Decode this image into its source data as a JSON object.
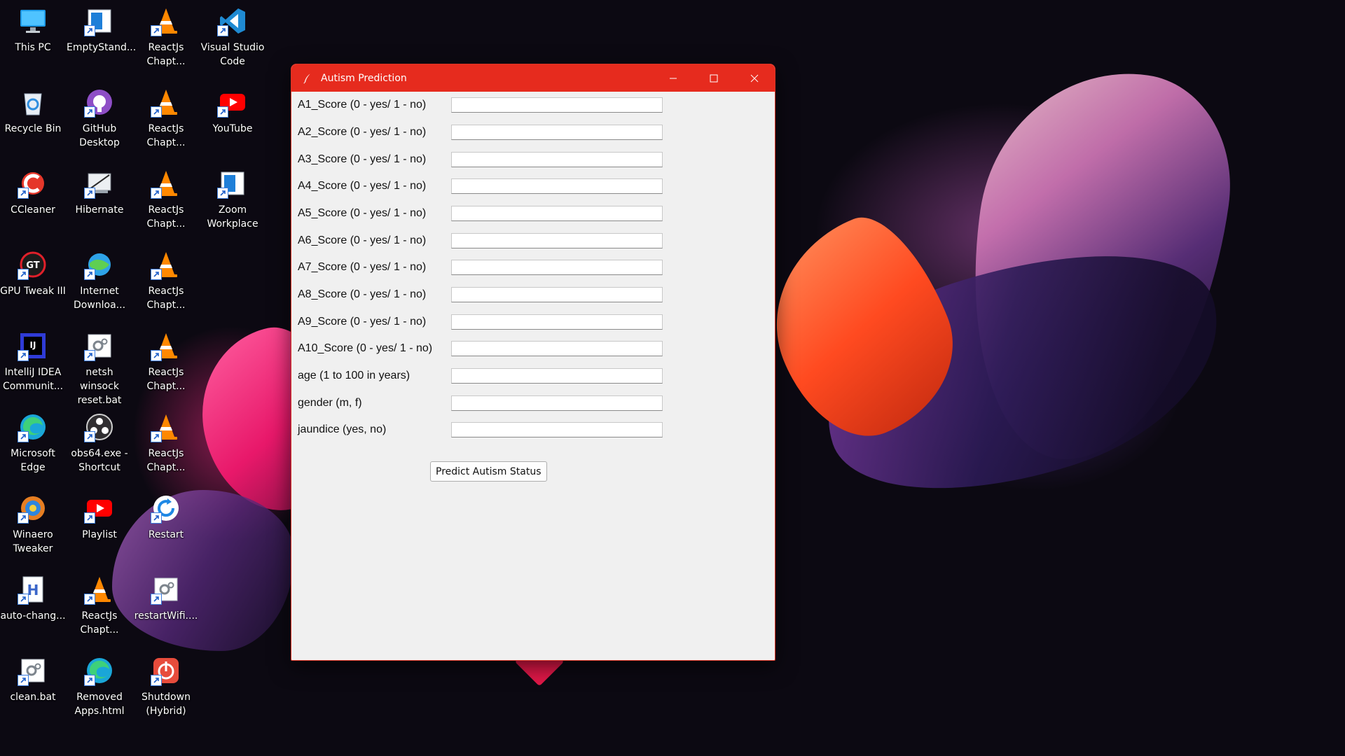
{
  "window": {
    "title": "Autism Prediction",
    "minimize_label": "Minimize",
    "maximize_label": "Maximize",
    "close_label": "Close"
  },
  "form": {
    "fields": [
      {
        "label": "A1_Score (0 - yes/ 1 - no)",
        "value": ""
      },
      {
        "label": "A2_Score (0 - yes/ 1 - no)",
        "value": ""
      },
      {
        "label": "A3_Score (0 - yes/ 1 - no)",
        "value": ""
      },
      {
        "label": "A4_Score (0 - yes/ 1 - no)",
        "value": ""
      },
      {
        "label": "A5_Score (0 - yes/ 1 - no)",
        "value": ""
      },
      {
        "label": "A6_Score (0 - yes/ 1 - no)",
        "value": ""
      },
      {
        "label": "A7_Score (0 - yes/ 1 - no)",
        "value": ""
      },
      {
        "label": "A8_Score (0 - yes/ 1 - no)",
        "value": ""
      },
      {
        "label": "A9_Score (0 - yes/ 1 - no)",
        "value": ""
      },
      {
        "label": "A10_Score (0 - yes/ 1 - no)",
        "value": ""
      },
      {
        "label": "age (1 to 100 in years)",
        "value": ""
      },
      {
        "label": "gender (m, f)",
        "value": ""
      },
      {
        "label": "jaundice (yes, no)",
        "value": ""
      }
    ],
    "submit_label": "Predict Autism Status"
  },
  "desktop": {
    "icons": [
      {
        "label": "This PC",
        "icon": "monitor-icon"
      },
      {
        "label": "Recycle Bin",
        "icon": "recycle-bin-icon"
      },
      {
        "label": "CCleaner",
        "icon": "ccleaner-icon"
      },
      {
        "label": "GPU Tweak III",
        "icon": "gpu-tweak-icon"
      },
      {
        "label": "IntelliJ IDEA\nCommunit...",
        "icon": "intellij-icon"
      },
      {
        "label": "Microsoft\nEdge",
        "icon": "edge-icon"
      },
      {
        "label": "Winaero\nTweaker",
        "icon": "winaero-icon"
      },
      {
        "label": "auto-chang...",
        "icon": "script-icon"
      },
      {
        "label": "clean.bat",
        "icon": "batch-gear-icon"
      },
      {
        "label": "EmptyStand...",
        "icon": "app-window-icon"
      },
      {
        "label": "GitHub\nDesktop",
        "icon": "github-icon"
      },
      {
        "label": "Hibernate",
        "icon": "hibernate-icon"
      },
      {
        "label": "Internet\nDownloa...",
        "icon": "idm-globe-icon"
      },
      {
        "label": "netsh winsock\nreset.bat",
        "icon": "batch-gear-icon"
      },
      {
        "label": "obs64.exe -\nShortcut",
        "icon": "obs-icon"
      },
      {
        "label": "Playlist",
        "icon": "youtube-icon"
      },
      {
        "label": "ReactJs\nChapt...",
        "icon": "vlc-cone-icon"
      },
      {
        "label": "ReactJs\nChapt...",
        "icon": "vlc-cone-icon"
      },
      {
        "label": "ReactJs\nChapt...",
        "icon": "vlc-cone-icon"
      },
      {
        "label": "ReactJs\nChapt...",
        "icon": "vlc-cone-icon"
      },
      {
        "label": "ReactJs\nChapt...",
        "icon": "vlc-cone-icon"
      },
      {
        "label": "ReactJs\nChapt...",
        "icon": "vlc-cone-icon"
      },
      {
        "label": "ReactJs\nChapt...",
        "icon": "vlc-cone-icon"
      },
      {
        "label": "Removed\nApps.html",
        "icon": "edge-icon"
      },
      {
        "label": "Restart",
        "icon": "restart-icon"
      },
      {
        "label": "restartWifi....",
        "icon": "batch-gear-icon"
      },
      {
        "label": "Shutdown\n(Hybrid)",
        "icon": "power-icon"
      },
      {
        "label": "Visual Studio\nCode",
        "icon": "vscode-icon"
      },
      {
        "label": "YouTube",
        "icon": "youtube-icon"
      },
      {
        "label": "Zoom\nWorkplace",
        "icon": "app-window-icon"
      }
    ]
  },
  "colors": {
    "title_bar": "#e62b1e",
    "window_bg": "#f0f0f0",
    "desktop_bg": "#0c0912"
  }
}
